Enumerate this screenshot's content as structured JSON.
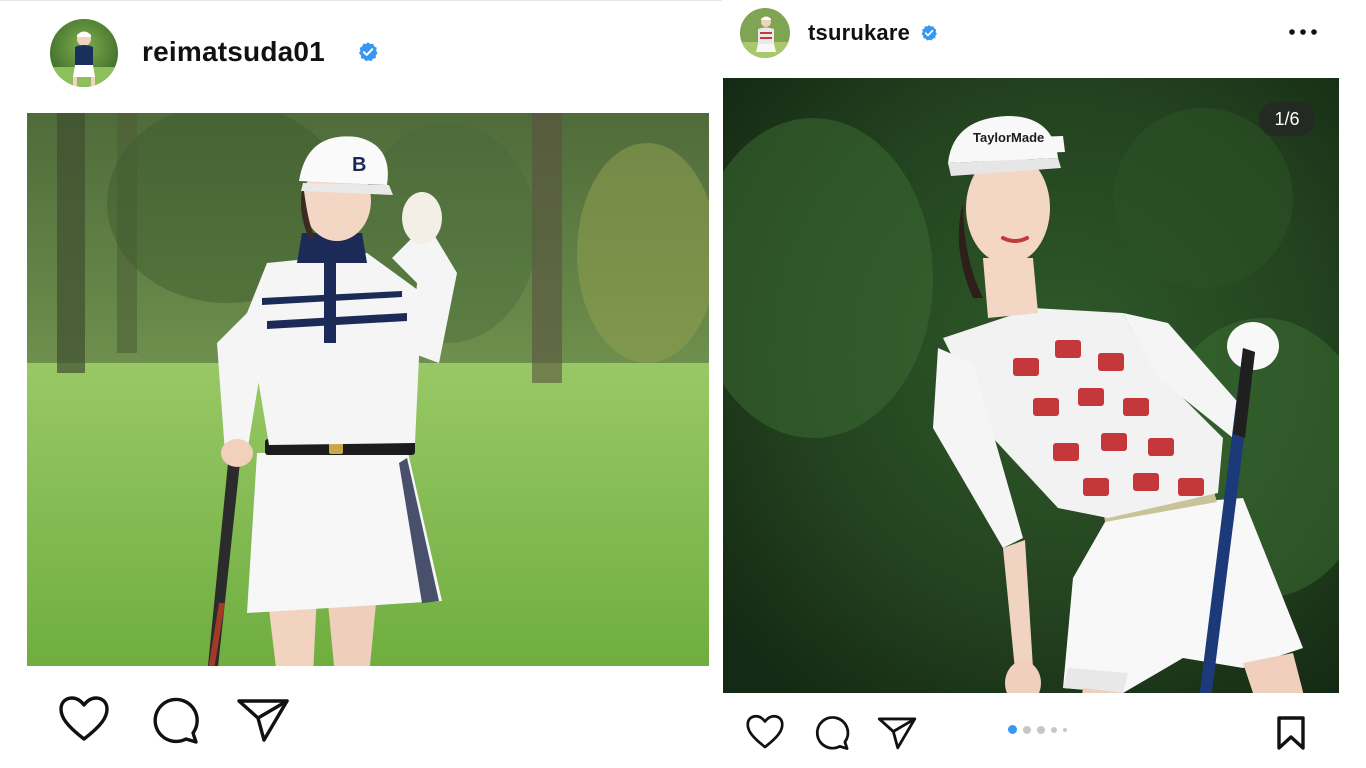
{
  "posts": [
    {
      "username": "reimatsuda01",
      "verified": true,
      "avatar_icon": "profile-avatar",
      "actions": [
        "heart-icon",
        "comment-icon",
        "share-icon"
      ]
    },
    {
      "username": "tsurukare",
      "verified": true,
      "avatar_icon": "profile-avatar",
      "more_icon": "more-options-icon",
      "carousel_counter": "1/6",
      "carousel_total": 6,
      "carousel_index": 1,
      "actions": [
        "heart-icon",
        "comment-icon",
        "share-icon"
      ],
      "save_icon": "bookmark-icon"
    }
  ],
  "colors": {
    "verified_blue": "#3897f0",
    "carousel_active": "#3897f0",
    "carousel_inactive": "#c7c7c7",
    "icon_stroke": "#111111"
  }
}
